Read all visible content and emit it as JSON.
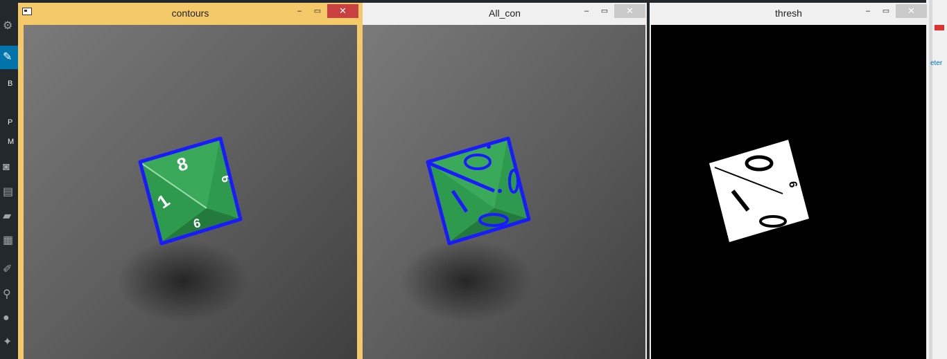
{
  "windows": [
    {
      "title": "contours",
      "minimize": "‒",
      "maximize": "▭",
      "close": "✕",
      "active": true
    },
    {
      "title": "All_con",
      "minimize": "‒",
      "maximize": "▭",
      "close": "✕",
      "active": false
    },
    {
      "title": "thresh",
      "minimize": "‒",
      "maximize": "▭",
      "close": "✕",
      "active": false
    }
  ],
  "background_app": {
    "sidebar_letters": [
      "B",
      "P",
      "M"
    ],
    "right_link_fragment": "eter"
  },
  "colors": {
    "active_frame": "#f3c969",
    "contour_blue": "#1a1aff",
    "die_green": "#2e9a4e",
    "surface_gray": "#6e6e6e"
  }
}
